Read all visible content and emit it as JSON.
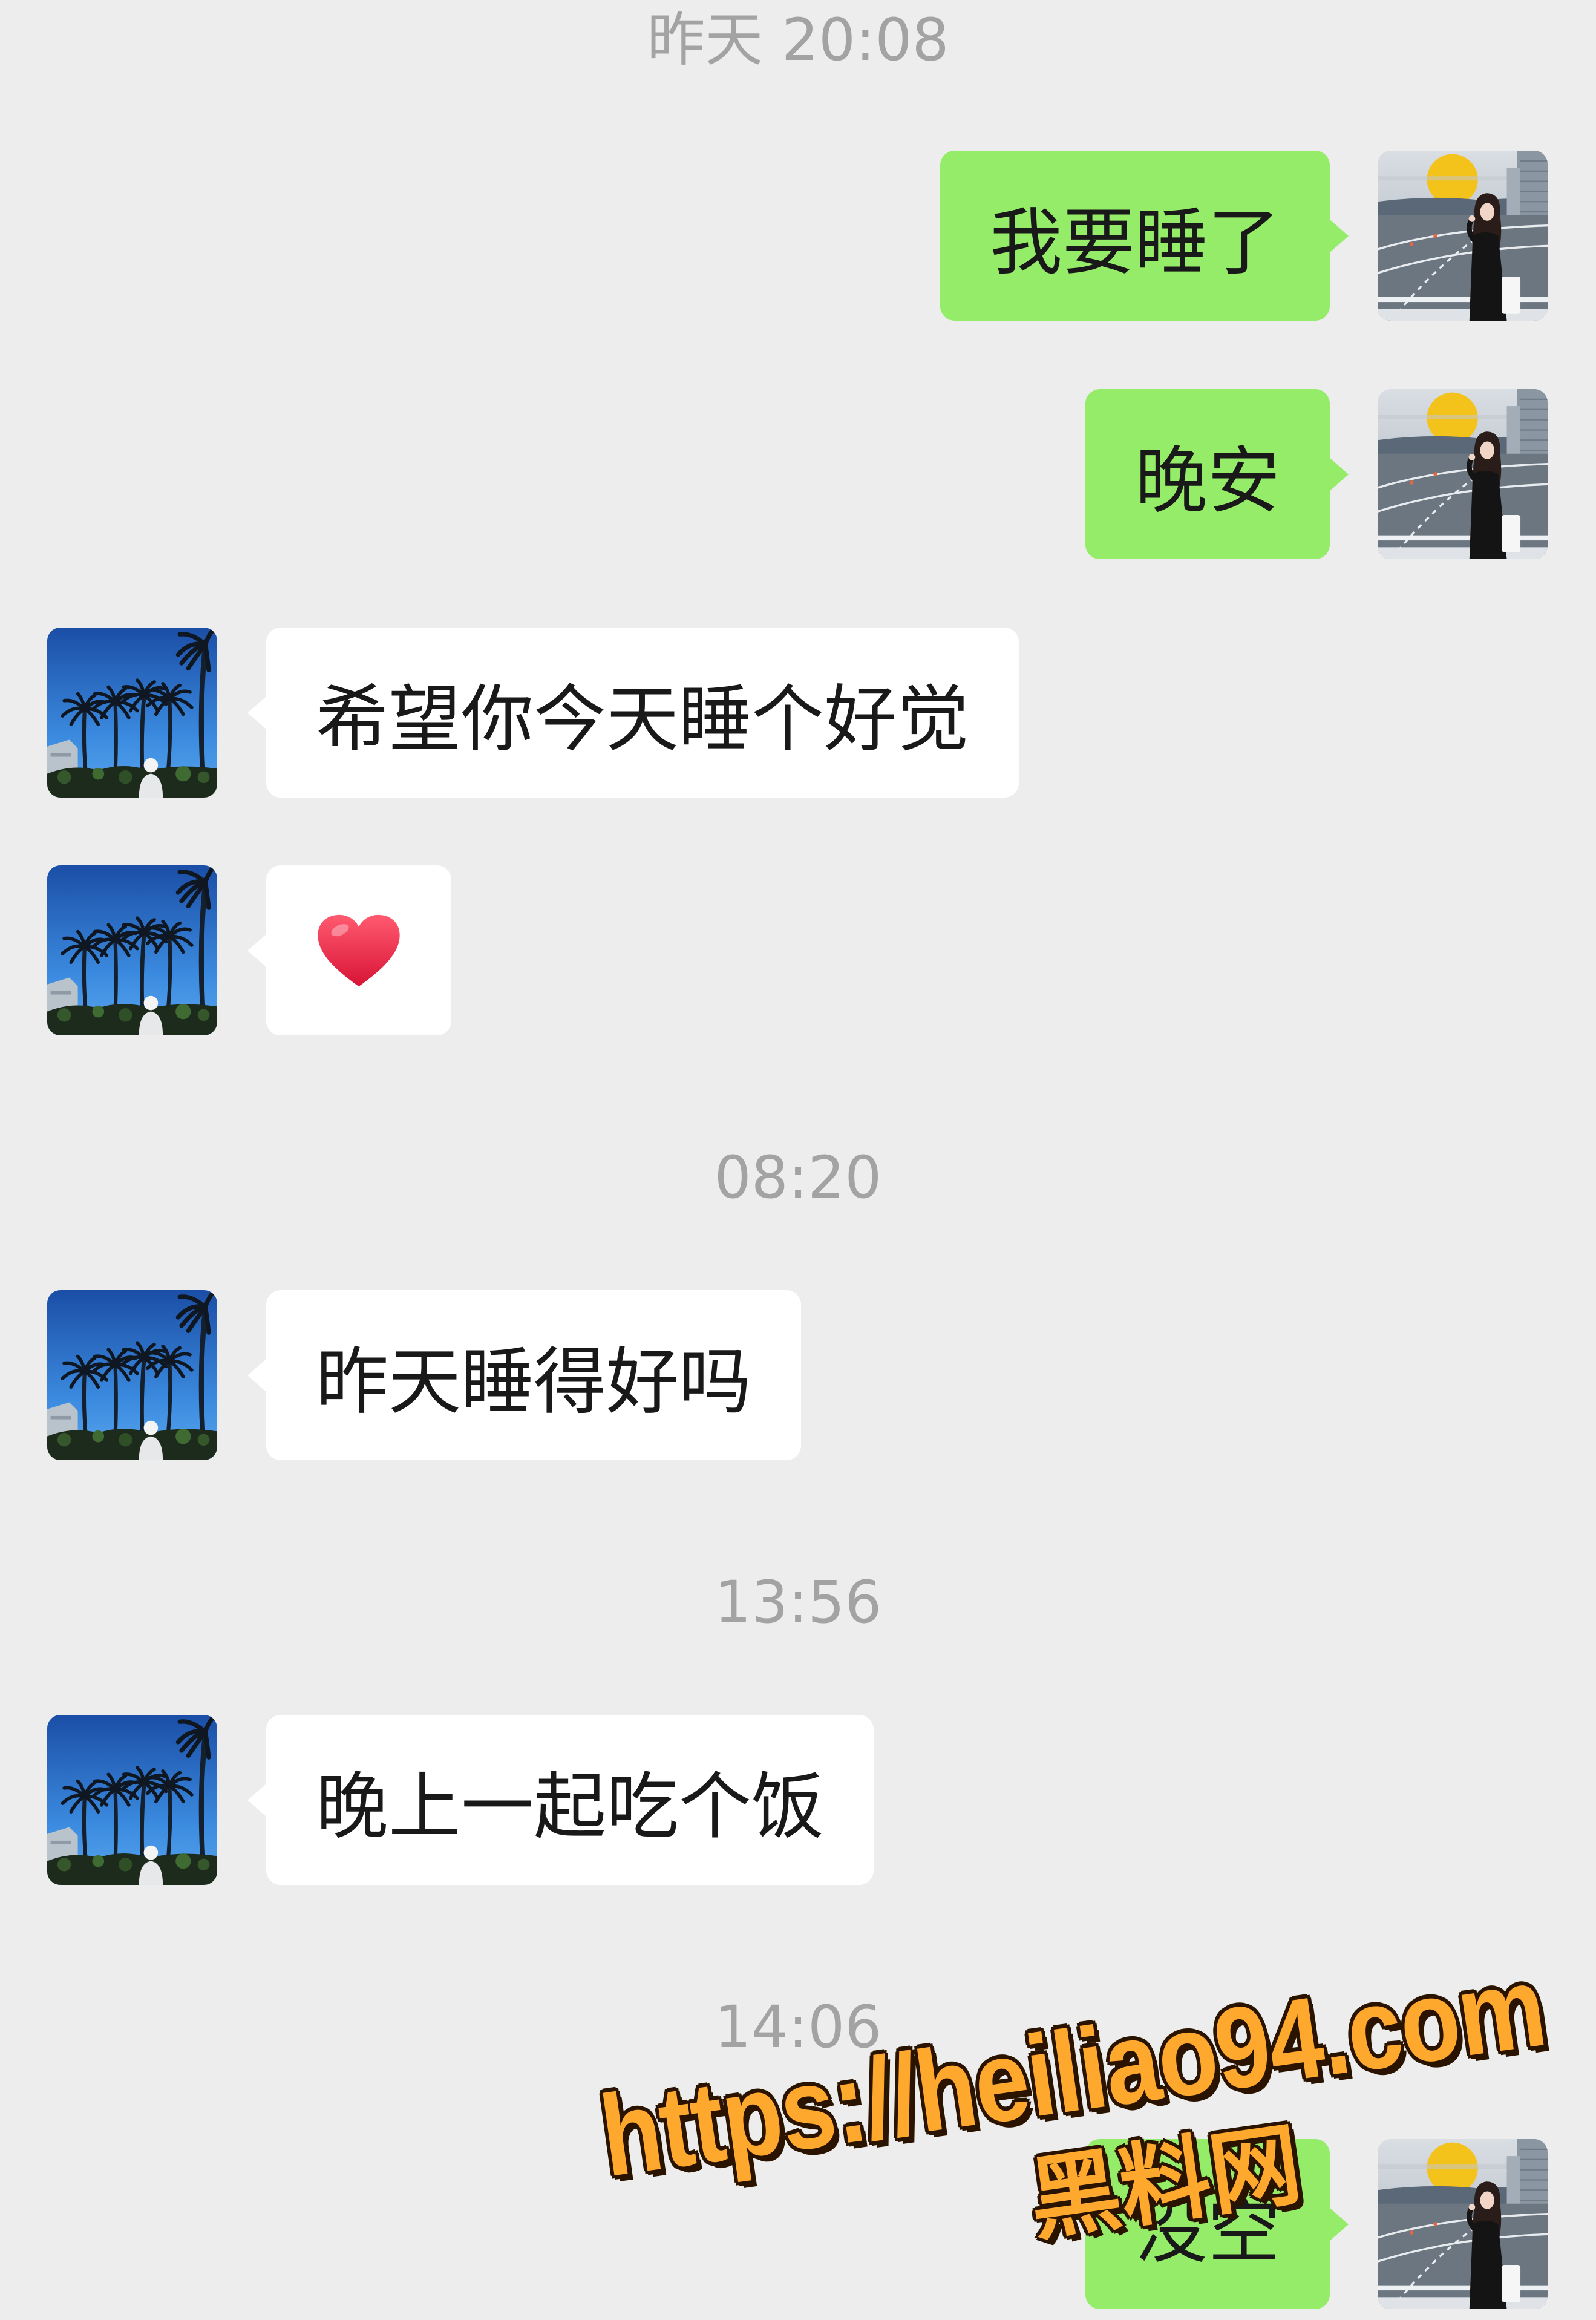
{
  "colors": {
    "background": "#ededed",
    "outgoing_bubble": "#95ec69",
    "incoming_bubble": "#ffffff",
    "timestamp": "#a3a3a3",
    "message_text": "#191919"
  },
  "avatars": {
    "me": "user-avatar",
    "contact": "contact-avatar"
  },
  "time_groups": [
    {
      "time": "昨天 20:08",
      "messages": [
        {
          "outgoing": true,
          "text": "我要睡了"
        },
        {
          "outgoing": true,
          "text": "晚安"
        },
        {
          "outgoing": false,
          "text": "希望你今天睡个好觉"
        },
        {
          "outgoing": false,
          "emoji": "heart-emoji"
        }
      ]
    },
    {
      "time": "08:20",
      "messages": [
        {
          "outgoing": false,
          "text": "昨天睡得好吗"
        }
      ]
    },
    {
      "time": "13:56",
      "messages": [
        {
          "outgoing": false,
          "text": "晚上一起吃个饭"
        }
      ]
    },
    {
      "time": "14:06",
      "messages": [
        {
          "outgoing": true,
          "text": "没空"
        }
      ]
    }
  ],
  "watermark": {
    "url": "https://heiliao94.com",
    "brand": "黑料网",
    "fill": "#ffa82e",
    "outline": "#2a1400"
  }
}
